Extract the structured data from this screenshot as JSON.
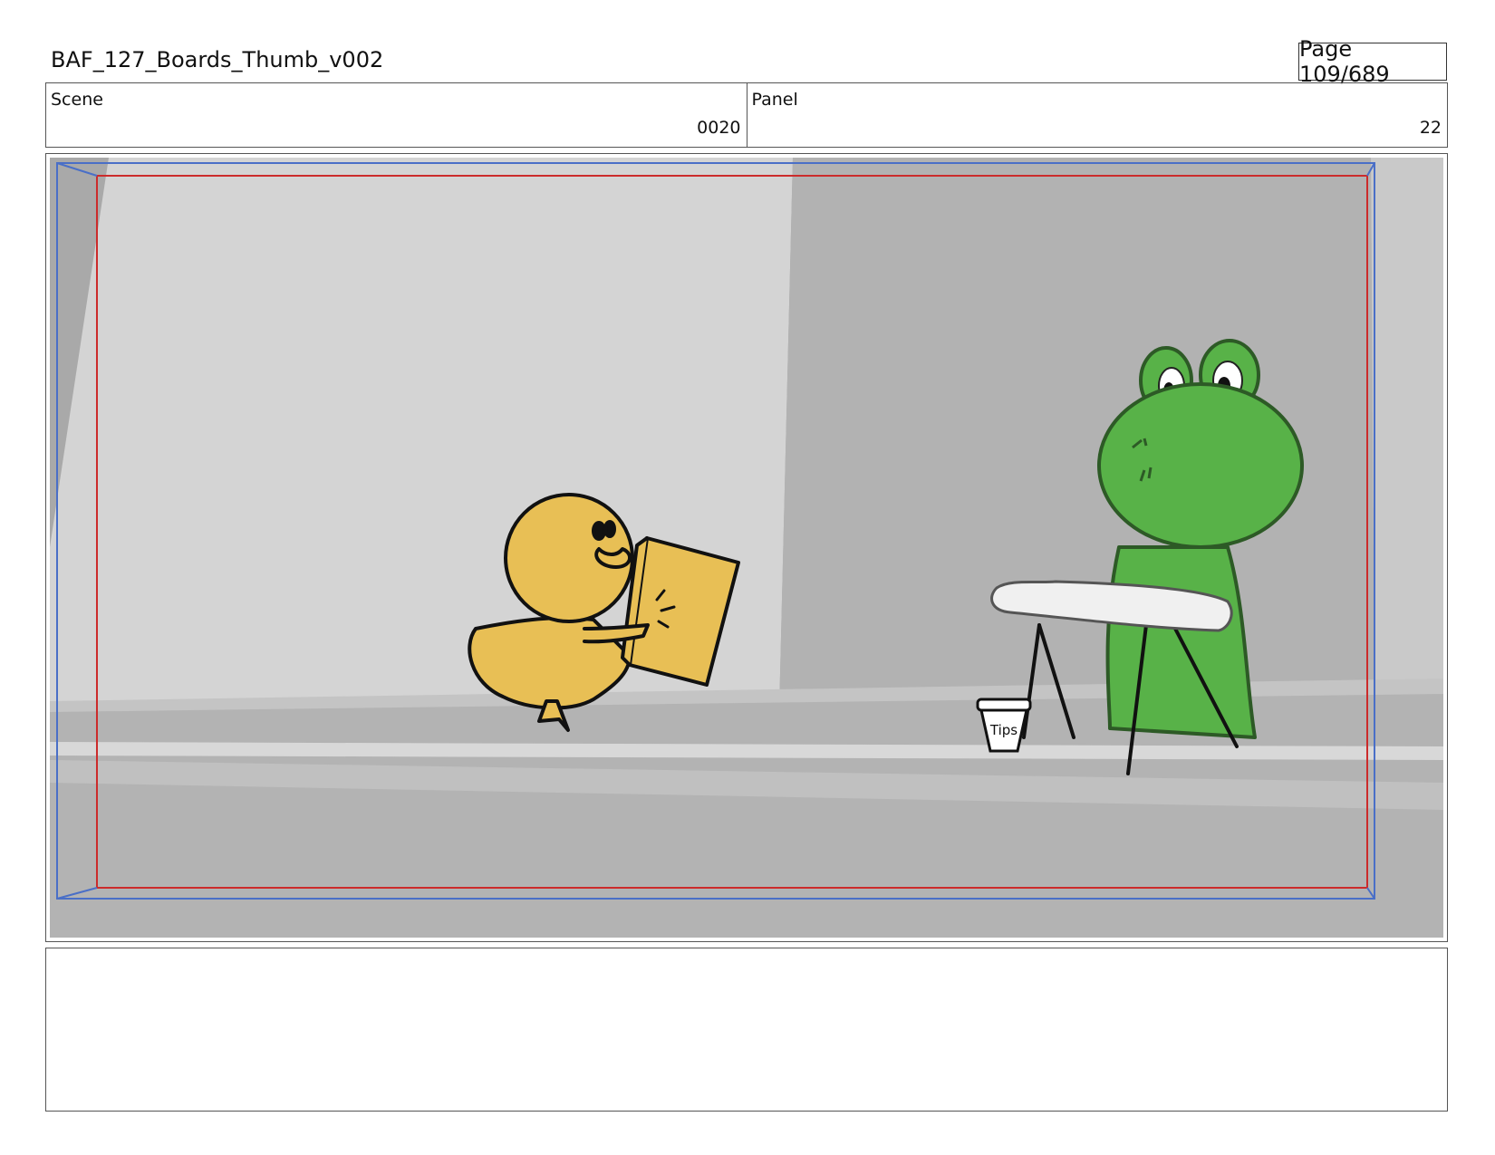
{
  "header": {
    "title": "BAF_127_Boards_Thumb_v002",
    "page": "Page 109/689"
  },
  "scene": {
    "label": "Scene",
    "value": "0020"
  },
  "panel": {
    "label": "Panel",
    "value": "22"
  },
  "artwork": {
    "cup_text": "Tips",
    "colors": {
      "duck": "#e8bf55",
      "frog": "#58b248",
      "safe_frame": "#cc2b2b",
      "camera_frame": "#4a6fc7"
    }
  }
}
